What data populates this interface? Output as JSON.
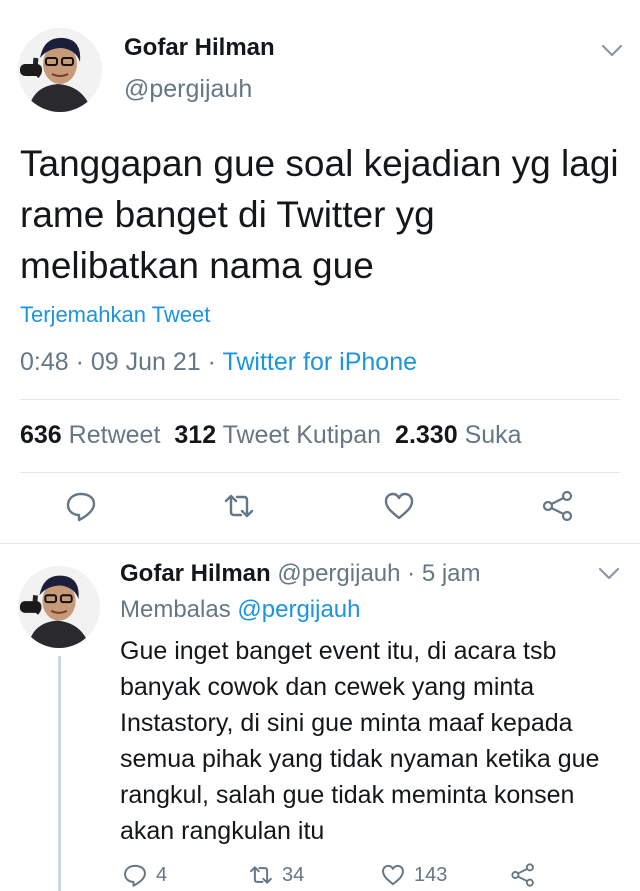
{
  "main_tweet": {
    "author_name": "Gofar Hilman",
    "author_handle": "@pergijauh",
    "text": "Tanggapan gue soal kejadian yg lagi rame banget di Twitter yg melibatkan nama gue",
    "translate_label": "Terjemahkan Tweet",
    "time": "0:48",
    "date": "09 Jun 21",
    "source": "Twitter for iPhone",
    "separator": " · ",
    "stats": {
      "retweets": "636",
      "retweets_label": "Retweet",
      "quotes": "312",
      "quotes_label": "Tweet Kutipan",
      "likes": "2.330",
      "likes_label": "Suka"
    },
    "actions": [
      "reply-icon",
      "retweet-icon",
      "like-icon",
      "share-icon"
    ]
  },
  "reply_tweet": {
    "author_name": "Gofar Hilman",
    "author_handle": "@pergijauh",
    "time_ago": "5 jam",
    "separator": " · ",
    "replying_to_label": "Membalas",
    "replying_to_handle": "@pergijauh",
    "text": "Gue inget banget event itu, di acara tsb banyak cowok dan cewek yang minta Instastory, di sini gue minta maaf kepada semua pihak yang tidak nyaman ketika gue rangkul, salah gue tidak meminta konsen akan rangkulan itu",
    "reply_count": "4",
    "retweet_count": "34",
    "like_count": "143"
  },
  "colors": {
    "text": "#14171a",
    "secondary": "#657786",
    "link": "#1b95e0",
    "divider": "#e1e8ed"
  }
}
